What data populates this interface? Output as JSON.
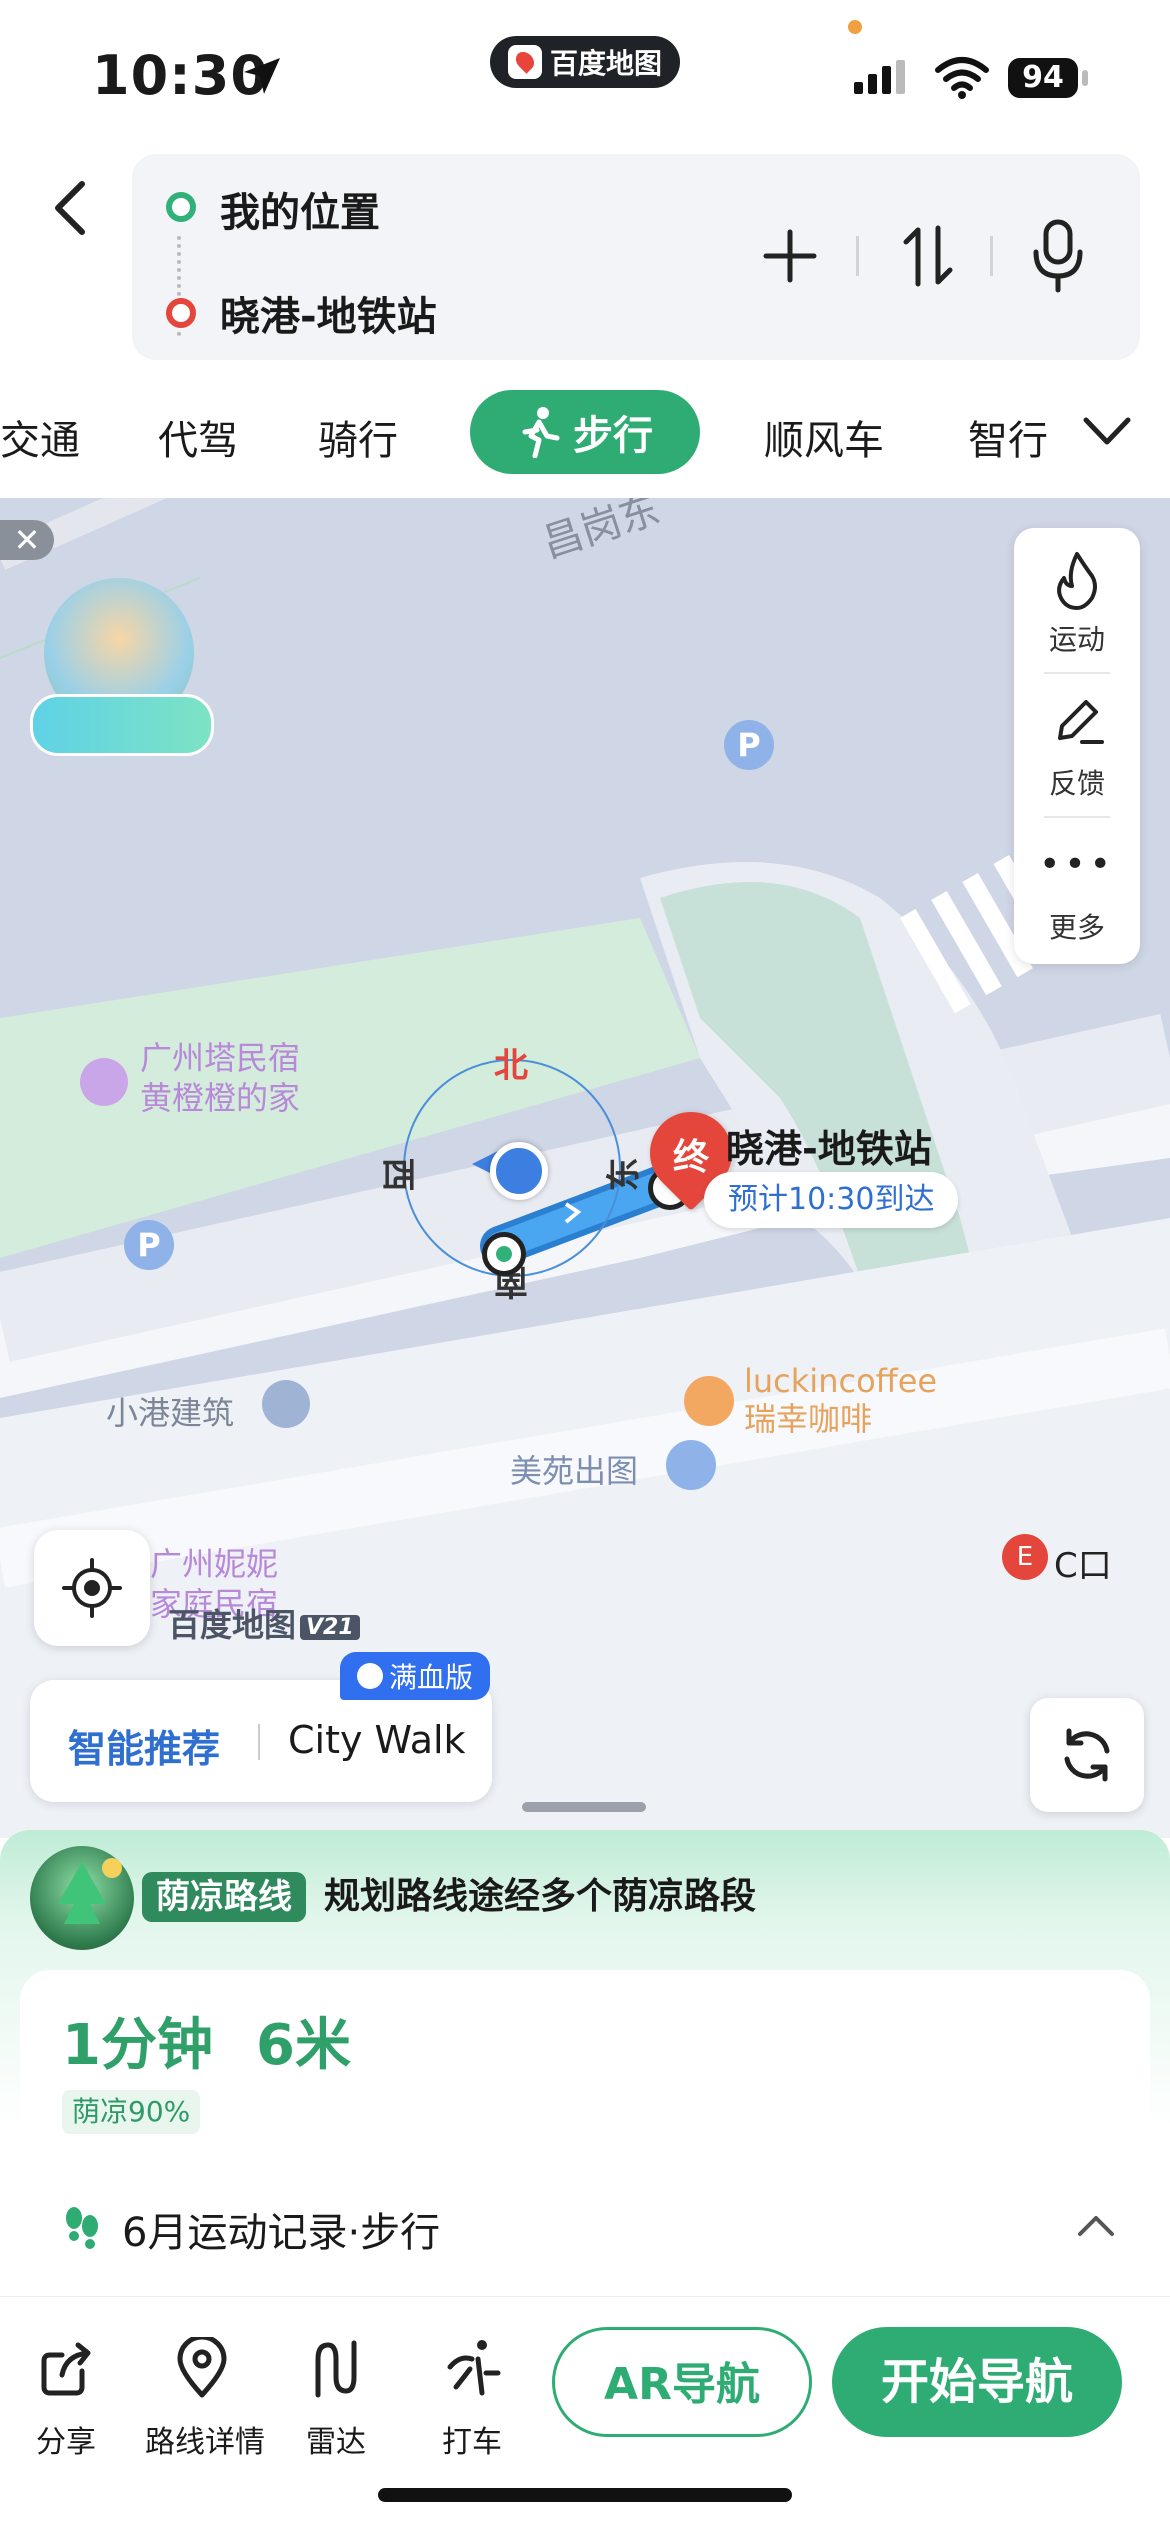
{
  "status_bar": {
    "time": "10:30",
    "app_pill": "百度地图",
    "battery": "94"
  },
  "route": {
    "origin": "我的位置",
    "destination": "晓港-地铁站"
  },
  "modes": {
    "items": [
      "交通",
      "代驾",
      "骑行",
      "顺风车",
      "智行"
    ],
    "active": "步行"
  },
  "side_panel": {
    "sport": "运动",
    "feedback": "反馈",
    "more": "更多"
  },
  "map": {
    "road_label": "昌岗东",
    "poi_hotel": "广州塔民宿\n黄橙橙的家",
    "poi_building": "小港建筑",
    "poi_coffee_en": "luckincoffee",
    "poi_coffee_cn": "瑞幸咖啡",
    "poi_photo": "美苑出图",
    "poi_home": "广州妮妮\n家庭民宿",
    "exit_label": "C口",
    "dest_label": "晓港-地铁站",
    "eta": "预计10:30到达",
    "end_marker": "终",
    "compass": {
      "north": "北",
      "south": "南",
      "east": "东",
      "west": "西"
    },
    "watermark": "百度地图",
    "watermark_version": "V21",
    "parking": "P"
  },
  "recommend": {
    "badge": "满血版",
    "smart": "智能推荐",
    "citywalk": "City Walk"
  },
  "sheet": {
    "shade_tag": "荫凉路线",
    "shade_desc": "规划路线途经多个荫凉路段",
    "duration": "1分钟",
    "distance": "6米",
    "shade_pct": "荫凉90%",
    "record": "6月运动记录·步行"
  },
  "toolbar": {
    "share": "分享",
    "details": "路线详情",
    "radar": "雷达",
    "taxi": "打车",
    "ar_nav": "AR导航",
    "start_nav": "开始导航"
  },
  "colors": {
    "accent_green": "#2fac74",
    "route_blue": "#3d9be9",
    "marker_red": "#e4463b"
  }
}
